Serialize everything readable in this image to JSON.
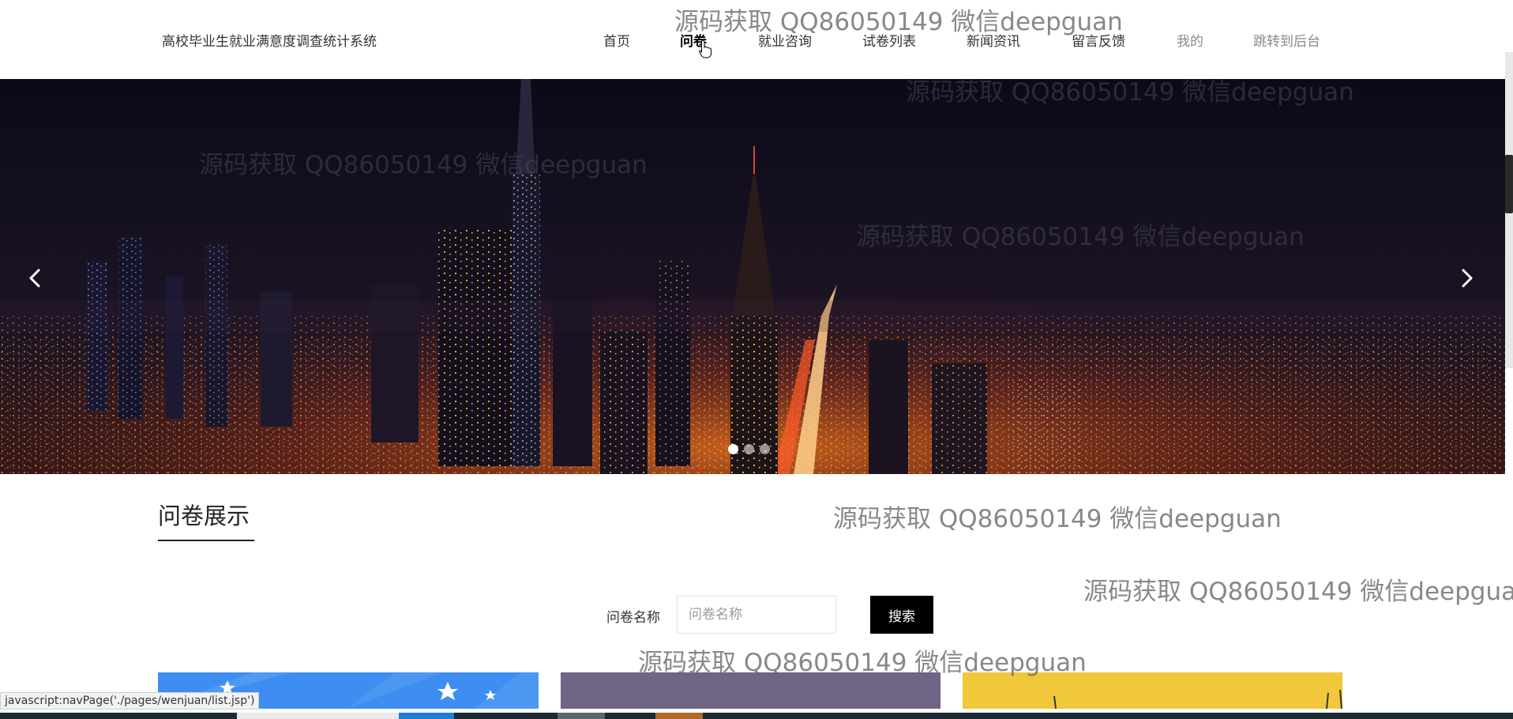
{
  "header": {
    "site_title": "高校毕业生就业满意度调查统计系统",
    "nav": [
      {
        "label": "首页"
      },
      {
        "label": "问卷"
      },
      {
        "label": "就业咨询"
      },
      {
        "label": "试卷列表"
      },
      {
        "label": "新闻资讯"
      },
      {
        "label": "留言反馈"
      },
      {
        "label": "我的"
      },
      {
        "label": "跳转到后台"
      }
    ],
    "active_nav": "问卷"
  },
  "watermark": {
    "text": "源码获取 QQ86050149 微信deepguan"
  },
  "banner": {
    "prev_icon": "chevron-left-icon",
    "next_icon": "chevron-right-icon",
    "slide_count": 3,
    "active_slide": 1
  },
  "section": {
    "title": "问卷展示"
  },
  "search": {
    "label": "问卷名称",
    "placeholder": "问卷名称",
    "button_label": "搜索"
  },
  "cards": [
    {
      "color": "#3d8ef0"
    },
    {
      "color": "#6f6585"
    },
    {
      "color": "#f0c83a"
    }
  ],
  "status_bar": {
    "url": "javascript:navPage('./pages/wenjuan/list.jsp')"
  }
}
